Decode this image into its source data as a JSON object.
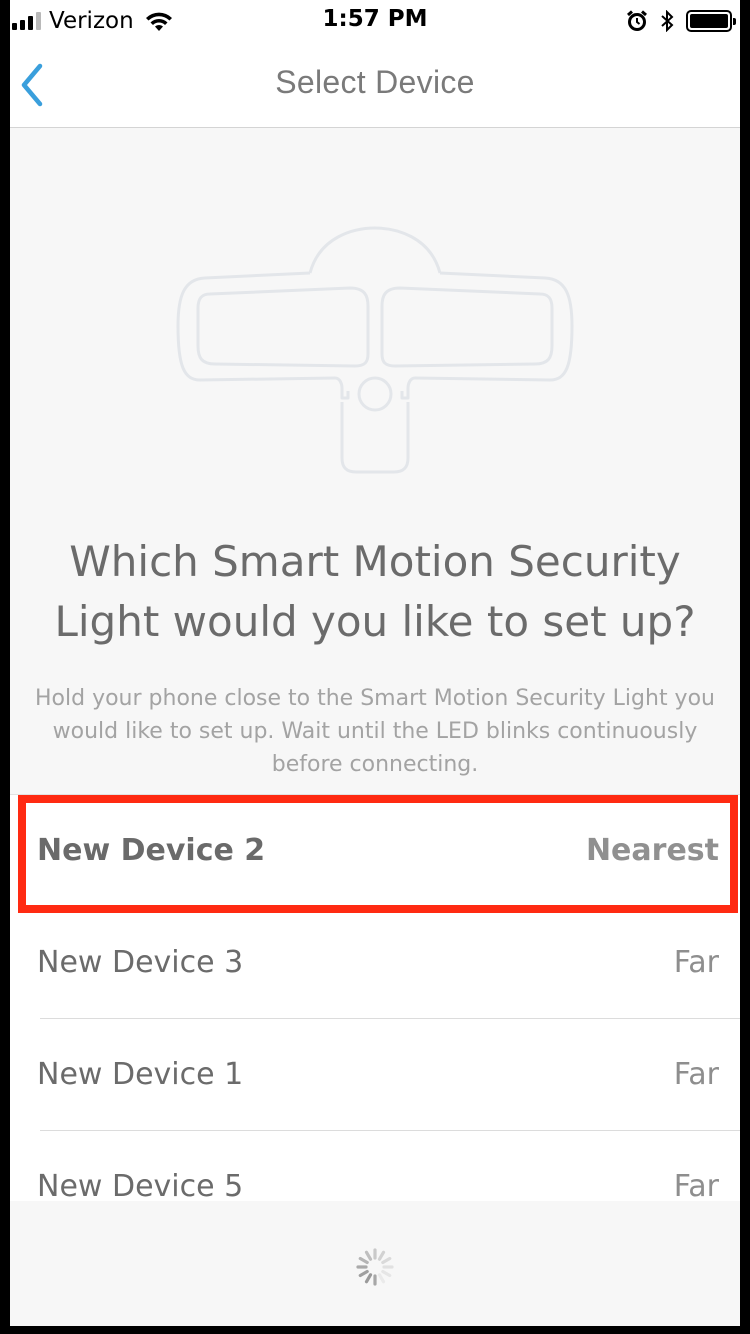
{
  "status_bar": {
    "carrier": "Verizon",
    "time": "1:57 PM",
    "signal_bars_filled": 3,
    "signal_bars_total": 4,
    "icons": [
      "wifi-icon",
      "alarm-icon",
      "bluetooth-icon",
      "battery-icon"
    ]
  },
  "nav": {
    "title": "Select Device",
    "back_icon": "chevron-left-icon"
  },
  "illustration": {
    "icon": "security-light-illustration"
  },
  "main": {
    "question": "Which Smart Motion Security Light would you like to set up?",
    "instructions": "Hold your phone close to the Smart Motion Security Light you would like to set up. Wait until the LED blinks continuously before connecting."
  },
  "devices": [
    {
      "name": "New Device 2",
      "distance": "Nearest",
      "selected": true
    },
    {
      "name": "New Device 3",
      "distance": "Far",
      "selected": false
    },
    {
      "name": "New Device 1",
      "distance": "Far",
      "selected": false
    },
    {
      "name": "New Device 5",
      "distance": "Far",
      "selected": false
    }
  ],
  "footer": {
    "spinner_icon": "loading-spinner-icon"
  },
  "colors": {
    "accent": "#3a9fdc",
    "highlight": "#ff2a12",
    "background": "#f7f7f7"
  }
}
